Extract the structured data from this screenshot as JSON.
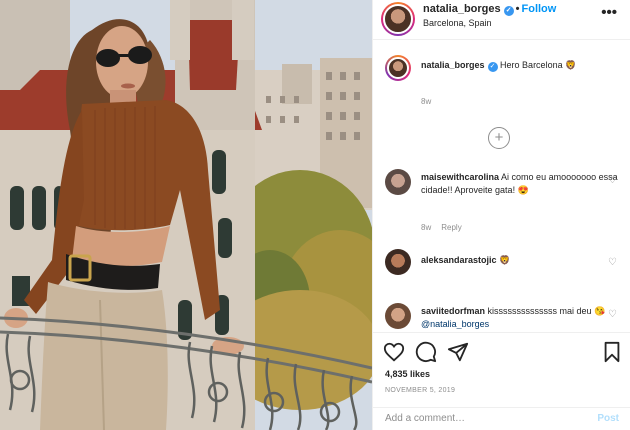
{
  "header": {
    "username": "natalia_borges",
    "separator": "•",
    "follow_label": "Follow",
    "location": "Barcelona, Spain",
    "more_label": "•••"
  },
  "caption": {
    "username": "natalia_borges",
    "text": "Hero Barcelona 🦁",
    "meta": "8w"
  },
  "load_more_label": "+",
  "comments": [
    {
      "username": "maisewithcarolina",
      "text": "Ai como eu amooooooo essa cidade!! Aproveite gata! 😍",
      "meta": "8w",
      "reply_label": "Reply"
    },
    {
      "username": "aleksandarastojic",
      "text": "🦁",
      "meta": "",
      "reply_label": ""
    },
    {
      "username": "saviitedorfman",
      "text": "kissssssssssssss mai deu 😘",
      "mention": "@natalia_borges",
      "meta": "",
      "reply_label": ""
    }
  ],
  "actions": {
    "likes": "4,835 likes",
    "timestamp": "NOVEMBER 5, 2019"
  },
  "add_comment": {
    "placeholder": "Add a comment…",
    "post_label": "Post"
  },
  "colors": {
    "accent": "#0095f6",
    "verified": "#3897f0",
    "post_disabled": "#b2dffc",
    "sweater": "#8b4a22"
  }
}
